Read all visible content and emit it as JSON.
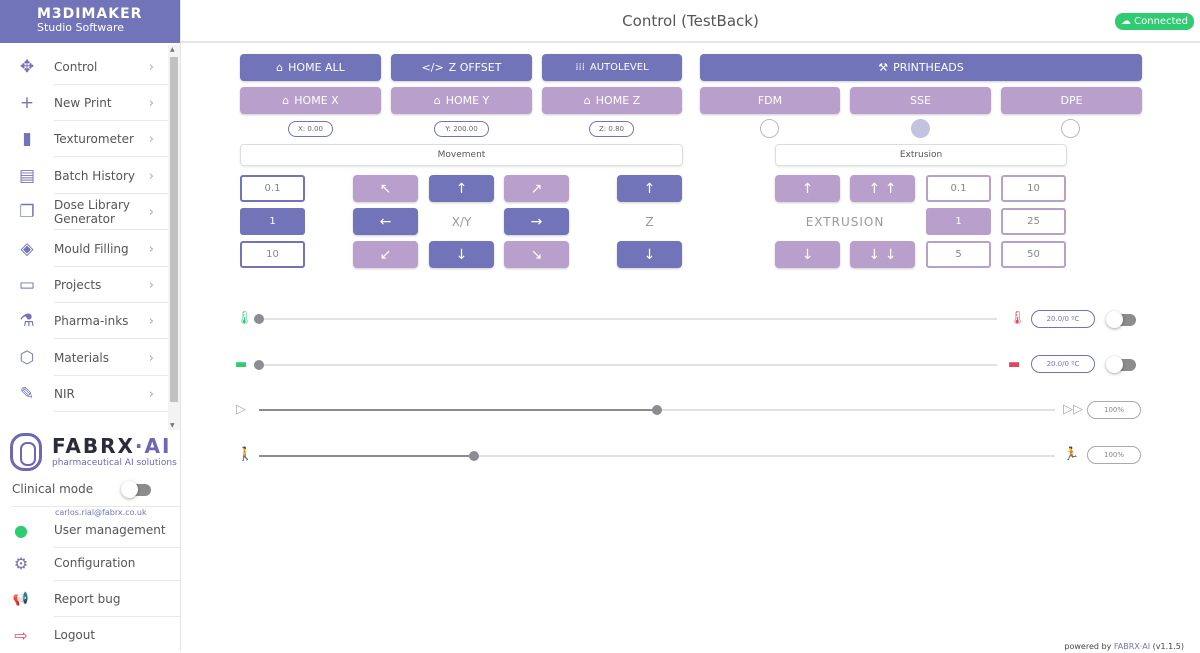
{
  "brand": {
    "line1": "M3DIMAKER",
    "line2": "Studio Software"
  },
  "sidebar": {
    "items": [
      {
        "label": "Control",
        "icon": "move-arrows-icon",
        "glyph": "✥"
      },
      {
        "label": "New Print",
        "icon": "plus-icon",
        "glyph": "+"
      },
      {
        "label": "Texturometer",
        "icon": "bar-chart-icon",
        "glyph": "▮"
      },
      {
        "label": "Batch History",
        "icon": "document-icon",
        "glyph": "▤"
      },
      {
        "label": "Dose Library Generator",
        "icon": "copy-files-icon",
        "glyph": "❐"
      },
      {
        "label": "Mould Filling",
        "icon": "paint-bucket-icon",
        "glyph": "◈"
      },
      {
        "label": "Projects",
        "icon": "folder-icon",
        "glyph": "▭"
      },
      {
        "label": "Pharma-inks",
        "icon": "flask-icon",
        "glyph": "⚗"
      },
      {
        "label": "Materials",
        "icon": "cube-icon",
        "glyph": "⬡"
      },
      {
        "label": "NIR",
        "icon": "flashlight-icon",
        "glyph": "✎"
      }
    ],
    "chevron": "›",
    "fabrx": {
      "name_a": "FABRX",
      "name_b": "·AI",
      "subtitle": "pharmaceutical AI solutions"
    },
    "clinical_mode": {
      "label": "Clinical mode",
      "enabled": false
    },
    "user_email": "carlos.rial@fabrx.co.uk",
    "bottom": [
      {
        "label": "User management",
        "icon": "user-icon",
        "glyph": "●",
        "color": "#2fcc71"
      },
      {
        "label": "Configuration",
        "icon": "gear-icon",
        "glyph": "⚙",
        "color": "#7174b8"
      },
      {
        "label": "Report bug",
        "icon": "megaphone-icon",
        "glyph": "📢",
        "color": "#e0455c"
      },
      {
        "label": "Logout",
        "icon": "logout-icon",
        "glyph": "⇨",
        "color": "#e0455c"
      }
    ]
  },
  "header": {
    "title": "Control (TestBack)",
    "status": "Connected",
    "status_color": "#2fcc71"
  },
  "toolbar": {
    "home_all": "HOME ALL",
    "z_offset": "Z OFFSET",
    "autolevel": "AUTOLEVEL",
    "printheads": "PRINTHEADS",
    "home_x": "HOME X",
    "home_y": "HOME Y",
    "home_z": "HOME Z",
    "fdm": "FDM",
    "sse": "SSE",
    "dpe": "DPE"
  },
  "positions": {
    "x": "X: 0.00",
    "y": "Y: 200.00",
    "z": "Z: 0.80"
  },
  "printhead_selected": "SSE",
  "movement": {
    "title": "Movement",
    "steps": [
      "0.1",
      "1",
      "10"
    ],
    "selected_step": "1",
    "xy_label": "X/Y",
    "z_label": "Z",
    "arrows": {
      "nw": "↖",
      "n": "↑",
      "ne": "↗",
      "w": "←",
      "e": "→",
      "sw": "↙",
      "s": "↓",
      "se": "↘"
    }
  },
  "extrusion": {
    "title": "Extrusion",
    "label": "EXTRUSION",
    "up": "↑",
    "up2": "↑ ↑",
    "down": "↓",
    "down2": "↓ ↓",
    "steps": [
      "0.1",
      "10",
      "1",
      "25",
      "5",
      "50"
    ],
    "selected_step": "1"
  },
  "sliders": {
    "extruder_temp": {
      "value": 0,
      "readout": "20.0/0 ºC",
      "heater_on": false
    },
    "bed_temp": {
      "value": 0,
      "readout": "20.0/0 ºC",
      "heater_on": false
    },
    "speed": {
      "value_percent": 50,
      "readout": "100%"
    },
    "flow": {
      "value_percent": 27,
      "readout": "100%"
    }
  },
  "footer": {
    "prefix": "powered by",
    "brand": "FABRX·AI",
    "version": "(v1.1.5)"
  }
}
